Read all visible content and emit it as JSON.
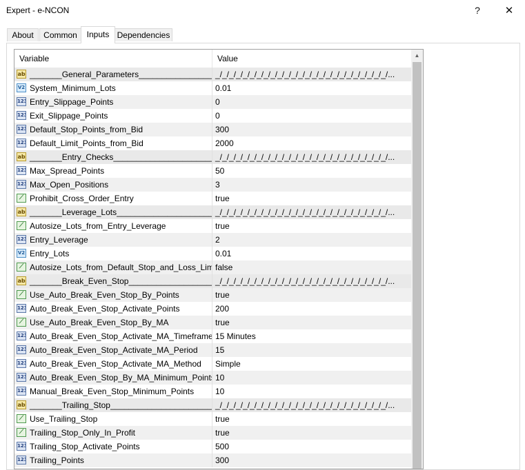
{
  "window": {
    "title": "Expert - e-NCON",
    "help": "?",
    "close": "✕"
  },
  "tabs": [
    {
      "label": "About",
      "active": false
    },
    {
      "label": "Common",
      "active": false
    },
    {
      "label": "Inputs",
      "active": true
    },
    {
      "label": "Dependencies",
      "active": false
    }
  ],
  "grid": {
    "headers": {
      "variable": "Variable",
      "value": "Value"
    },
    "rows": [
      {
        "icon": "ab",
        "name": "_______General_Parameters____________________...",
        "value": "_/_/_/_/_/_/_/_/_/_/_/_/_/_/_/_/_/_/_/_/_/_/_/_/_/..."
      },
      {
        "icon": "v2",
        "name": "System_Minimum_Lots",
        "value": "0.01"
      },
      {
        "icon": "i123",
        "name": "Entry_Slippage_Points",
        "value": "0"
      },
      {
        "icon": "i123",
        "name": "Exit_Slippage_Points",
        "value": "0"
      },
      {
        "icon": "i123",
        "name": "Default_Stop_Points_from_Bid",
        "value": "300"
      },
      {
        "icon": "i123",
        "name": "Default_Limit_Points_from_Bid",
        "value": "2000"
      },
      {
        "icon": "ab",
        "name": "_______Entry_Checks____________________________...",
        "value": "_/_/_/_/_/_/_/_/_/_/_/_/_/_/_/_/_/_/_/_/_/_/_/_/_/..."
      },
      {
        "icon": "i123",
        "name": "Max_Spread_Points",
        "value": "50"
      },
      {
        "icon": "i123",
        "name": "Max_Open_Positions",
        "value": "3"
      },
      {
        "icon": "b",
        "name": "Prohibit_Cross_Order_Entry",
        "value": "true"
      },
      {
        "icon": "ab",
        "name": "_______Leverage_Lots____________________________...",
        "value": "_/_/_/_/_/_/_/_/_/_/_/_/_/_/_/_/_/_/_/_/_/_/_/_/_/..."
      },
      {
        "icon": "b",
        "name": "Autosize_Lots_from_Entry_Leverage",
        "value": "true"
      },
      {
        "icon": "i123",
        "name": "Entry_Leverage",
        "value": "2"
      },
      {
        "icon": "v2",
        "name": "Entry_Lots",
        "value": "0.01"
      },
      {
        "icon": "b",
        "name": "Autosize_Lots_from_Default_Stop_and_Loss_Limit",
        "value": "false"
      },
      {
        "icon": "ab",
        "name": "_______Break_Even_Stop__________________________...",
        "value": "_/_/_/_/_/_/_/_/_/_/_/_/_/_/_/_/_/_/_/_/_/_/_/_/_/..."
      },
      {
        "icon": "b",
        "name": "Use_Auto_Break_Even_Stop_By_Points",
        "value": "true"
      },
      {
        "icon": "i123",
        "name": "Auto_Break_Even_Stop_Activate_Points",
        "value": "200"
      },
      {
        "icon": "b",
        "name": "Use_Auto_Break_Even_Stop_By_MA",
        "value": "true"
      },
      {
        "icon": "i123",
        "name": "Auto_Break_Even_Stop_Activate_MA_Timeframe",
        "value": "15 Minutes"
      },
      {
        "icon": "i123",
        "name": "Auto_Break_Even_Stop_Activate_MA_Period",
        "value": "15"
      },
      {
        "icon": "i123",
        "name": "Auto_Break_Even_Stop_Activate_MA_Method",
        "value": "Simple"
      },
      {
        "icon": "i123",
        "name": "Auto_Break_Even_Stop_By_MA_Minimum_Points",
        "value": "10"
      },
      {
        "icon": "i123",
        "name": "Manual_Break_Even_Stop_Minimum_Points",
        "value": "10"
      },
      {
        "icon": "ab",
        "name": "_______Trailing_Stop____________________________...",
        "value": "_/_/_/_/_/_/_/_/_/_/_/_/_/_/_/_/_/_/_/_/_/_/_/_/_/..."
      },
      {
        "icon": "b",
        "name": "Use_Trailing_Stop",
        "value": "true"
      },
      {
        "icon": "b",
        "name": "Trailing_Stop_Only_In_Profit",
        "value": "true"
      },
      {
        "icon": "i123",
        "name": "Trailing_Stop_Activate_Points",
        "value": "500"
      },
      {
        "icon": "i123",
        "name": "Trailing_Points",
        "value": "300"
      }
    ]
  },
  "icon_glyphs": {
    "ab": "ab",
    "v2": "V2",
    "b": "⟋",
    "i123": "123"
  }
}
